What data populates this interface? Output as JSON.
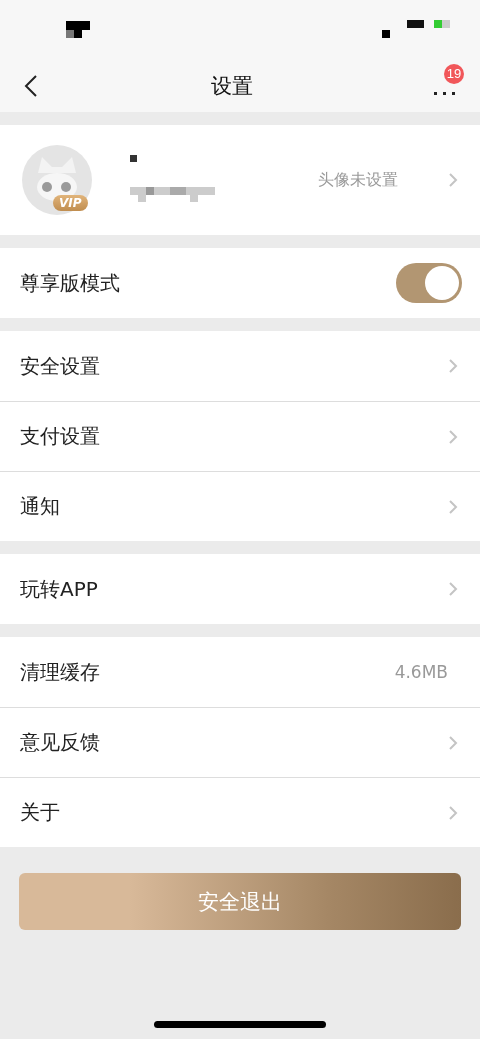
{
  "nav": {
    "title": "设置",
    "badge": "19"
  },
  "profile": {
    "avatar_badge": "VIP",
    "hint": "头像未设置"
  },
  "sections": [
    {
      "rows": [
        {
          "kind": "toggle",
          "label": "尊享版模式",
          "on": true
        }
      ]
    },
    {
      "rows": [
        {
          "kind": "link",
          "label": "安全设置"
        },
        {
          "kind": "link",
          "label": "支付设置"
        },
        {
          "kind": "link",
          "label": "通知"
        }
      ]
    },
    {
      "rows": [
        {
          "kind": "link",
          "label": "玩转APP"
        }
      ]
    },
    {
      "rows": [
        {
          "kind": "value",
          "label": "清理缓存",
          "value": "4.6MB"
        },
        {
          "kind": "link",
          "label": "意见反馈"
        },
        {
          "kind": "link",
          "label": "关于"
        }
      ]
    }
  ],
  "logout_button": "安全退出"
}
